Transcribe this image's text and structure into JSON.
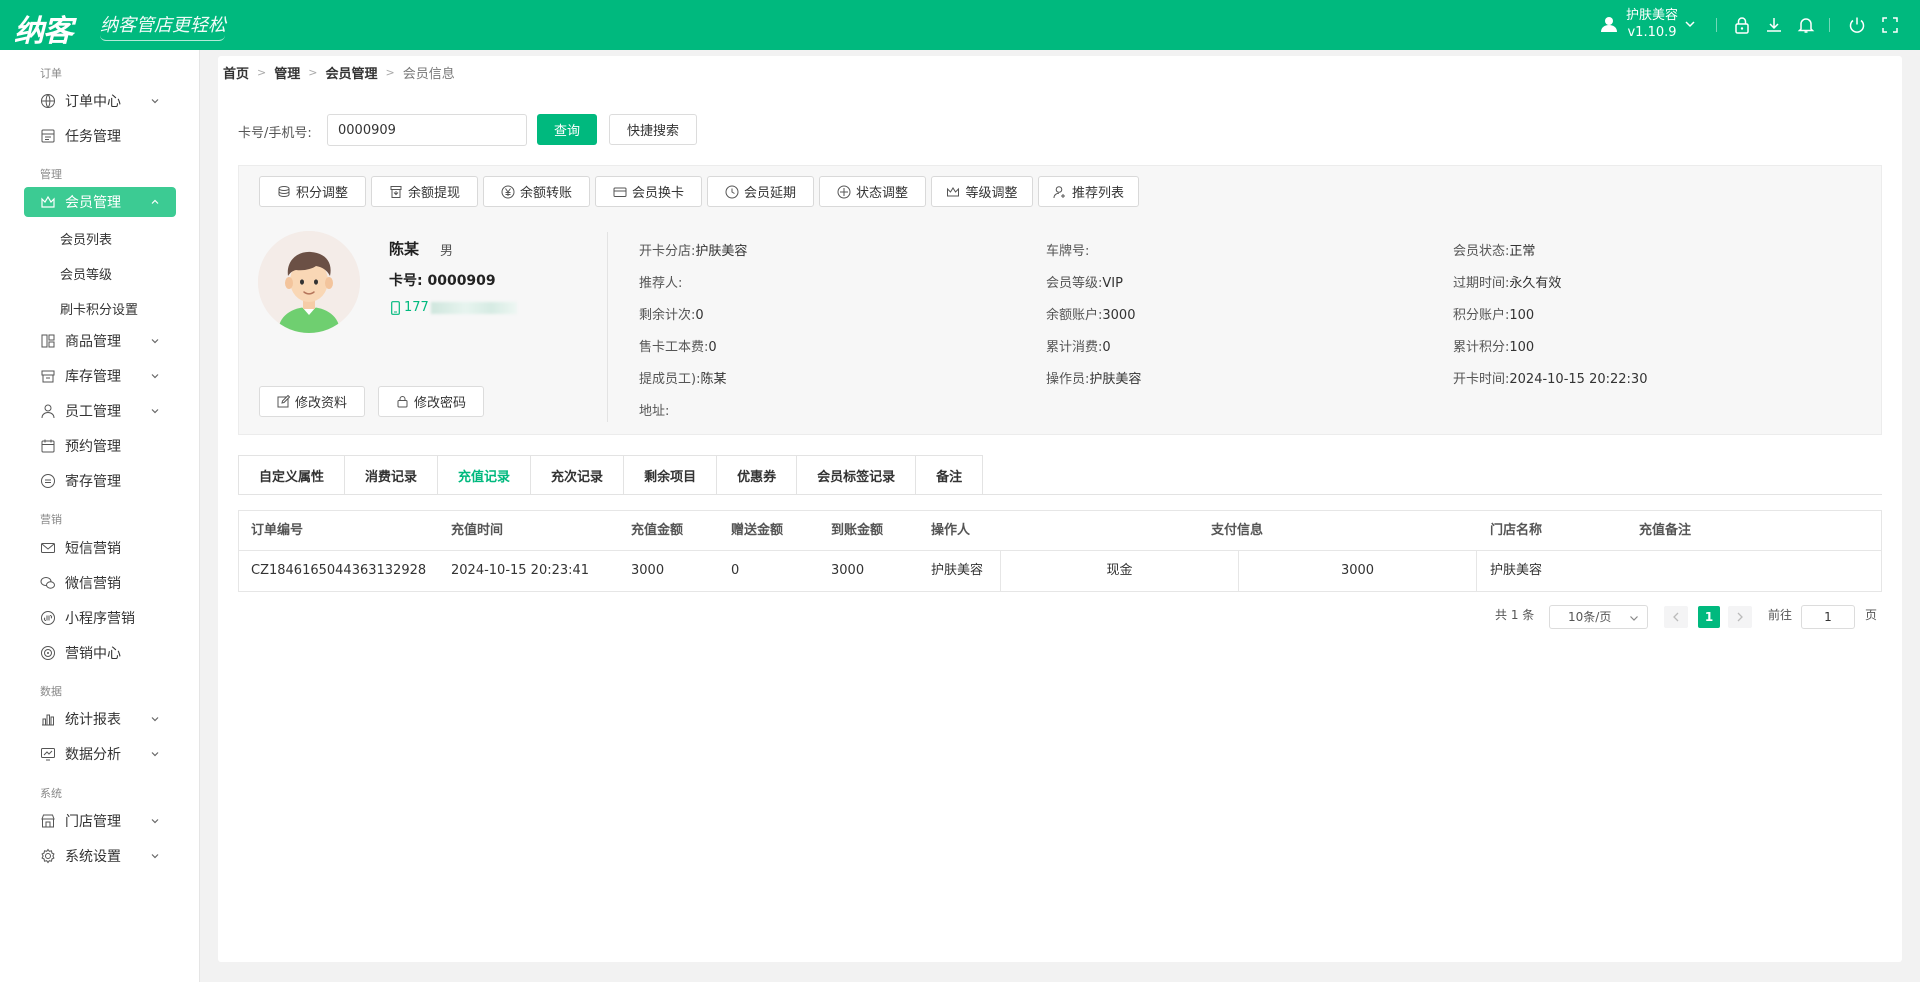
{
  "header": {
    "logo_text": "纳客",
    "slogan": "纳客管店更轻松",
    "user_name": "护肤美容",
    "version": "v1.10.9",
    "accent_color": "#00b97e",
    "icons": [
      "user-icon",
      "caret-down-icon",
      "lock-icon",
      "download-icon",
      "bell-icon",
      "power-icon",
      "fullscreen-icon"
    ]
  },
  "sidebar": {
    "groups": {
      "order": "订单",
      "manage": "管理",
      "marketing": "营销",
      "data": "数据",
      "system": "系统"
    },
    "items": {
      "order_center": "订单中心",
      "task_manage": "任务管理",
      "member_manage": "会员管理",
      "member_list": "会员列表",
      "member_level": "会员等级",
      "swipe_points": "刷卡积分设置",
      "goods_manage": "商品管理",
      "stock_manage": "库存管理",
      "staff_manage": "员工管理",
      "booking_manage": "预约管理",
      "deposit_manage": "寄存管理",
      "sms_marketing": "短信营销",
      "wechat_marketing": "微信营销",
      "miniapp_marketing": "小程序营销",
      "marketing_center": "营销中心",
      "stats_report": "统计报表",
      "data_analysis": "数据分析",
      "store_manage": "门店管理",
      "system_settings": "系统设置"
    }
  },
  "breadcrumb": [
    "首页",
    "管理",
    "会员管理",
    "会员信息"
  ],
  "search": {
    "label": "卡号/手机号:",
    "value": "0000909",
    "query_button": "查询",
    "quick_search_button": "快捷搜索"
  },
  "actions": [
    "积分调整",
    "余额提现",
    "余额转账",
    "会员换卡",
    "会员延期",
    "状态调整",
    "等级调整",
    "推荐列表"
  ],
  "member": {
    "name": "陈某",
    "gender": "男",
    "card": "卡号: 0000909",
    "phone_prefix": "177",
    "edit_info_button": "修改资料",
    "edit_password_button": "修改密码"
  },
  "fields": {
    "col1": [
      {
        "label": "开卡分店:",
        "value": "护肤美容"
      },
      {
        "label": "推荐人:",
        "value": ""
      },
      {
        "label": "剩余计次:",
        "value": "0"
      },
      {
        "label": "售卡工本费:",
        "value": "0"
      },
      {
        "label": "提成员工):",
        "value": "陈某"
      },
      {
        "label": "地址:",
        "value": ""
      }
    ],
    "col2": [
      {
        "label": "车牌号:",
        "value": ""
      },
      {
        "label": "会员等级:",
        "value": "VIP"
      },
      {
        "label": "余额账户:",
        "value": "3000"
      },
      {
        "label": "累计消费:",
        "value": "0"
      },
      {
        "label": "操作员:",
        "value": "护肤美容"
      }
    ],
    "col3": [
      {
        "label": "会员状态:",
        "value": "正常"
      },
      {
        "label": "过期时间:",
        "value": "永久有效"
      },
      {
        "label": "积分账户:",
        "value": "100"
      },
      {
        "label": "累计积分:",
        "value": "100"
      },
      {
        "label": "开卡时间:",
        "value": "2024-10-15 20:22:30"
      }
    ]
  },
  "tabs": [
    "自定义属性",
    "消费记录",
    "充值记录",
    "充次记录",
    "剩余项目",
    "优惠券",
    "会员标签记录",
    "备注"
  ],
  "active_tab": "充值记录",
  "table": {
    "headers": [
      "订单编号",
      "充值时间",
      "充值金额",
      "赠送金额",
      "到账金额",
      "操作人",
      "支付信息",
      "门店名称",
      "充值备注"
    ],
    "rows": [
      {
        "order_no": "CZ1846165044363132928",
        "time": "2024-10-15 20:23:41",
        "amount": "3000",
        "gift": "0",
        "received": "3000",
        "operator": "护肤美容",
        "pay_method": "现金",
        "pay_amount": "3000",
        "store": "护肤美容",
        "remark": ""
      }
    ]
  },
  "pagination": {
    "total": "共 1 条",
    "page_size": "10条/页",
    "current": "1",
    "goto_label": "前往",
    "goto_value": "1",
    "page_unit": "页"
  }
}
